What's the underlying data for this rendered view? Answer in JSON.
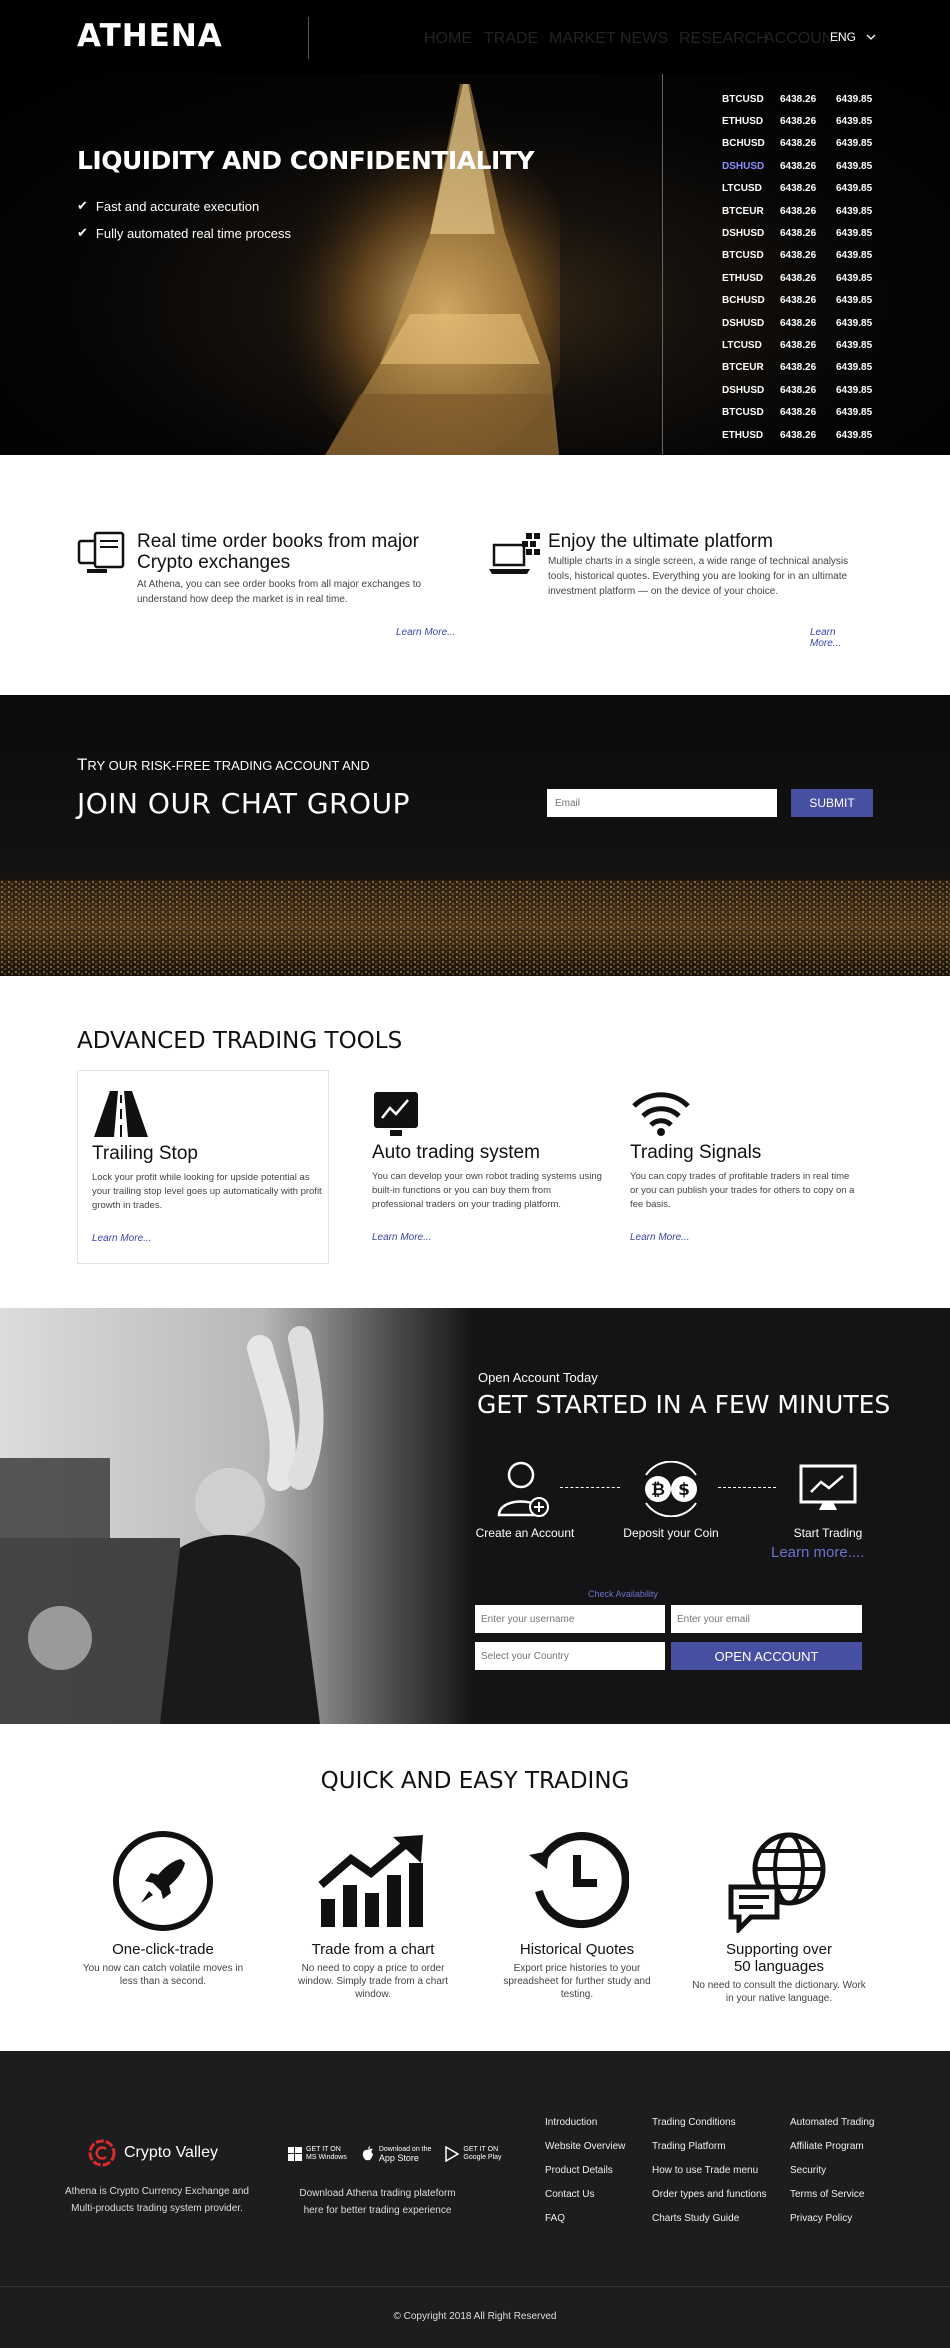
{
  "nav": {
    "logo": "ATHENA",
    "items": [
      "HOME",
      "TRADE",
      "MARKET",
      "NEWS",
      "RESEARCH",
      "ACCOUNT"
    ],
    "lang": "ENG"
  },
  "hero": {
    "title": "LIQUIDITY AND CONFIDENTIALITY",
    "bullets": [
      "Fast and accurate execution",
      "Fully automated real time process"
    ]
  },
  "ticker": [
    {
      "sym": "BTCUSD",
      "bid": "6438.26",
      "ask": "6439.85"
    },
    {
      "sym": "ETHUSD",
      "bid": "6438.26",
      "ask": "6439.85"
    },
    {
      "sym": "BCHUSD",
      "bid": "6438.26",
      "ask": "6439.85"
    },
    {
      "sym": "DSHUSD",
      "bid": "6438.26",
      "ask": "6439.85"
    },
    {
      "sym": "LTCUSD",
      "bid": "6438.26",
      "ask": "6439.85"
    },
    {
      "sym": "BTCEUR",
      "bid": "6438.26",
      "ask": "6439.85"
    },
    {
      "sym": "DSHUSD",
      "bid": "6438.26",
      "ask": "6439.85"
    },
    {
      "sym": "BTCUSD",
      "bid": "6438.26",
      "ask": "6439.85"
    },
    {
      "sym": "ETHUSD",
      "bid": "6438.26",
      "ask": "6439.85"
    },
    {
      "sym": "BCHUSD",
      "bid": "6438.26",
      "ask": "6439.85"
    },
    {
      "sym": "DSHUSD",
      "bid": "6438.26",
      "ask": "6439.85"
    },
    {
      "sym": "LTCUSD",
      "bid": "6438.26",
      "ask": "6439.85"
    },
    {
      "sym": "BTCEUR",
      "bid": "6438.26",
      "ask": "6439.85"
    },
    {
      "sym": "DSHUSD",
      "bid": "6438.26",
      "ask": "6439.85"
    },
    {
      "sym": "BTCUSD",
      "bid": "6438.26",
      "ask": "6439.85"
    },
    {
      "sym": "ETHUSD",
      "bid": "6438.26",
      "ask": "6439.85"
    }
  ],
  "features": [
    {
      "title": "Real time order books from major Crypto exchanges",
      "text": "At Athena, you can see order books from all major exchanges to understand how deep the market is in real time.",
      "link": "Learn More..."
    },
    {
      "title": "Enjoy the ultimate platform",
      "text": "Multiple charts in a single screen, a wide range of technical analysis tools, historical quotes. Everything you are looking for in an ultimate investment platform — on the device of your choice.",
      "link": "Learn More..."
    }
  ],
  "chat": {
    "sub_first": "T",
    "sub_rest": "RY OUR RISK-FREE TRADING ACCOUNT AND",
    "title": "JOIN OUR CHAT GROUP",
    "placeholder": "Email",
    "button": "SUBMIT"
  },
  "tools": {
    "title": "ADVANCED TRADING TOOLS",
    "items": [
      {
        "title": "Trailing Stop",
        "text": "Lock your profit while looking for upside potential as your trailing stop level goes up automatically with profit growth in trades.",
        "link": "Learn More..."
      },
      {
        "title": "Auto trading system",
        "text": "You can develop your own robot trading systems using built-in functions or you can buy them from professional traders on your trading platform.",
        "link": "Learn More..."
      },
      {
        "title": "Trading Signals",
        "text": "You can copy trades of profitable traders in real time or you can publish your trades for others to copy on a fee basis.",
        "link": "Learn More..."
      }
    ]
  },
  "get_started": {
    "small": "Open Account Today",
    "title": "GET STARTED IN A FEW MINUTES",
    "steps": [
      "Create an Account",
      "Deposit your Coin",
      "Start Trading"
    ],
    "learn": "Learn more....",
    "check": "Check Availability",
    "username_ph": "Enter your username",
    "email_ph": "Enter your email",
    "country_ph": "Select your Country",
    "button": "OPEN ACCOUNT"
  },
  "quick": {
    "title": "QUICK AND EASY TRADING",
    "items": [
      {
        "title": "One-click-trade",
        "text": "You now can catch volatile moves in less than a second."
      },
      {
        "title": "Trade from a chart",
        "text": "No need to copy a price to order window. Simply trade from a chart window."
      },
      {
        "title": "Historical Quotes",
        "text": "Export price histories to your spreadsheet for further study and testing."
      },
      {
        "title": "Supporting over 50 languages",
        "text": "No need to consult the dictionary. Work in your native language."
      }
    ]
  },
  "footer": {
    "brand": "Crypto Valley",
    "brand_desc": "Athena is Crypto Currency Exchange and Multi-products trading system provider.",
    "stores": [
      {
        "top": "GET IT ON",
        "bottom": "MS Windows"
      },
      {
        "top": "Download on the",
        "bottom": "App Store"
      },
      {
        "top": "GET IT ON",
        "bottom": "Google Play"
      }
    ],
    "store_desc": "Download Athena trading plateform here for better trading experience",
    "col1": [
      "Introduction",
      "Website Overview",
      "Product Details",
      "Contact Us",
      "FAQ"
    ],
    "col2": [
      "Trading Conditions",
      "Trading Platform",
      "How to use Trade menu",
      "Order types and functions",
      "Charts Study Guide"
    ],
    "col3": [
      "Automated Trading",
      "Affiliate Program",
      "Security",
      "Terms of Service",
      "Privacy Policy"
    ],
    "copyright": "© Copyright 2018 All Right Reserved"
  }
}
